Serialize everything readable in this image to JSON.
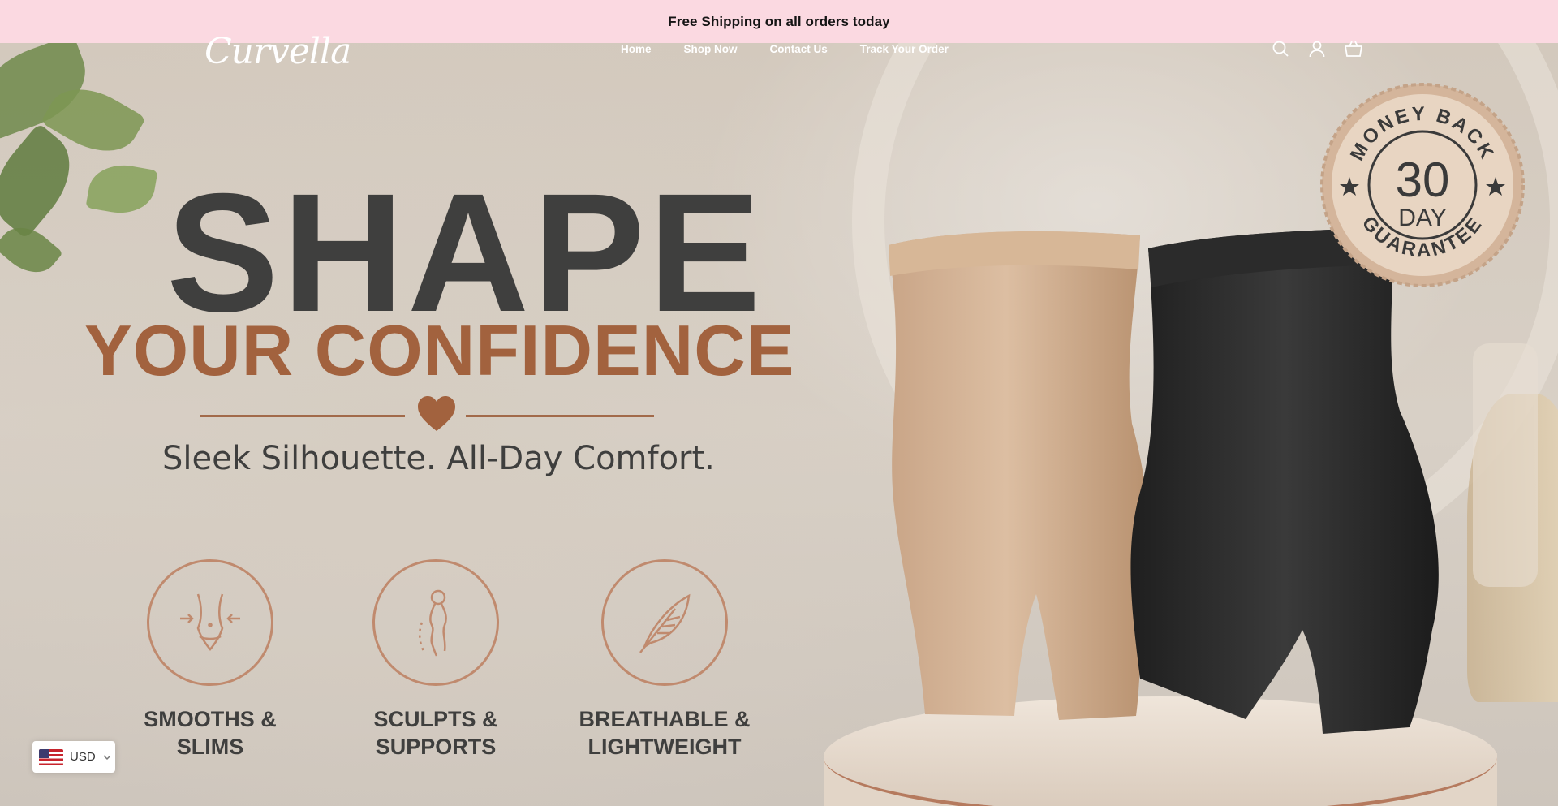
{
  "announcement": {
    "text": "Free Shipping on all orders today"
  },
  "header": {
    "logo": "Curvella",
    "nav": [
      "Home",
      "Shop Now",
      "Contact Us",
      "Track Your Order"
    ],
    "icons": [
      "search-icon",
      "account-icon",
      "cart-icon"
    ]
  },
  "hero": {
    "headline_1": "SHAPE",
    "headline_2": "YOUR CONFIDENCE",
    "tagline": "Sleek Silhouette. All-Day Comfort.",
    "features": [
      {
        "line1": "SMOOTHS &",
        "line2": "SLIMS",
        "icon": "waist-icon"
      },
      {
        "line1": "SCULPTS &",
        "line2": "SUPPORTS",
        "icon": "body-profile-icon"
      },
      {
        "line1": "BREATHABLE &",
        "line2": "LIGHTWEIGHT",
        "icon": "feather-icon"
      }
    ],
    "badge": {
      "top": "MONEY BACK",
      "number": "30",
      "unit": "DAY",
      "bottom": "GUARANTEE"
    }
  },
  "currency": {
    "code": "USD"
  },
  "colors": {
    "announcement_bg": "#fbd9e1",
    "headline": "#3f3f3e",
    "accent": "#a2623e"
  }
}
